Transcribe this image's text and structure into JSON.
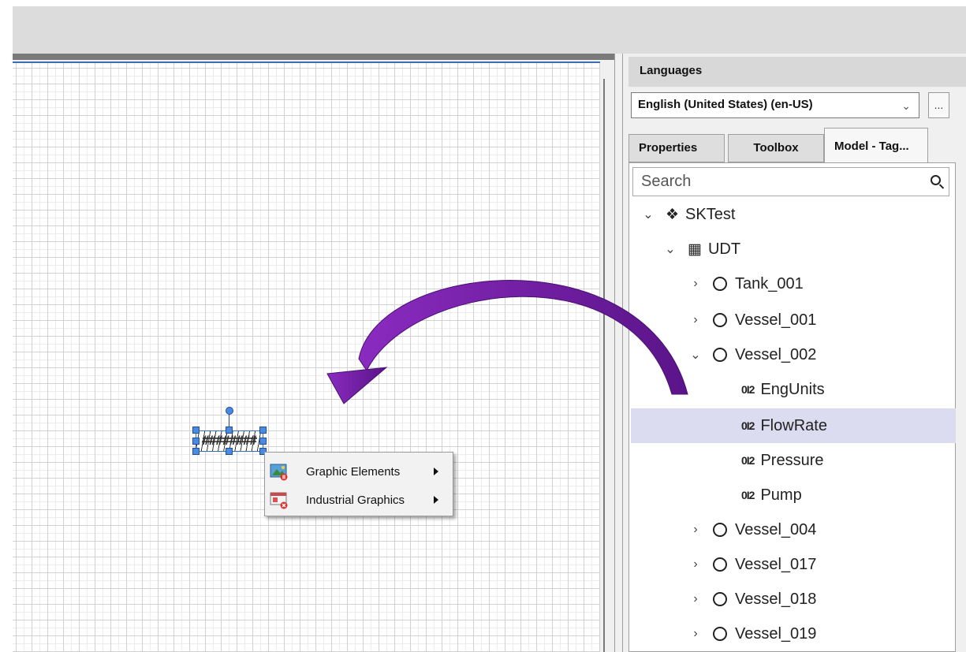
{
  "canvas": {
    "selected_element_text": "########"
  },
  "context_menu": {
    "items": [
      {
        "label": "Graphic Elements",
        "icon": "graphic-elements-icon"
      },
      {
        "label": "Industrial Graphics",
        "icon": "industrial-graphics-icon"
      }
    ]
  },
  "right_panel": {
    "languages_header": "Languages",
    "language_selected": "English (United States) (en-US)",
    "more_button": "...",
    "tabs": [
      {
        "label": "Properties",
        "active": false
      },
      {
        "label": "Toolbox",
        "active": false
      },
      {
        "label": "Model - Tag...",
        "active": true
      }
    ],
    "search_placeholder": "Search",
    "tree": [
      {
        "label": "SKTest",
        "depth": 0,
        "expander": "expanded",
        "icon": "galaxy-icon"
      },
      {
        "label": "UDT",
        "depth": 1,
        "expander": "expanded",
        "icon": "udt-icon"
      },
      {
        "label": "Tank_001",
        "depth": 2,
        "expander": "collapsed",
        "icon": "object-circle-icon"
      },
      {
        "label": "Vessel_001",
        "depth": 2,
        "expander": "collapsed",
        "icon": "object-circle-icon"
      },
      {
        "label": "Vessel_002",
        "depth": 2,
        "expander": "expanded",
        "icon": "object-circle-icon"
      },
      {
        "label": "EngUnits",
        "depth": 3,
        "expander": "none",
        "icon": "attribute-icon",
        "icon_text": "012"
      },
      {
        "label": "FlowRate",
        "depth": 3,
        "expander": "none",
        "icon": "attribute-icon",
        "icon_text": "012",
        "selected": true
      },
      {
        "label": "Pressure",
        "depth": 3,
        "expander": "none",
        "icon": "attribute-icon",
        "icon_text": "012"
      },
      {
        "label": "Pump",
        "depth": 3,
        "expander": "none",
        "icon": "attribute-icon",
        "icon_text": "012"
      },
      {
        "label": "Vessel_004",
        "depth": 2,
        "expander": "collapsed",
        "icon": "object-circle-icon"
      },
      {
        "label": "Vessel_017",
        "depth": 2,
        "expander": "collapsed",
        "icon": "object-circle-icon"
      },
      {
        "label": "Vessel_018",
        "depth": 2,
        "expander": "collapsed",
        "icon": "object-circle-icon"
      },
      {
        "label": "Vessel_019",
        "depth": 2,
        "expander": "collapsed",
        "icon": "object-circle-icon"
      }
    ]
  },
  "colors": {
    "selection_highlight": "#dcdcf1",
    "arrow_purple": "#6a1a9a",
    "handle_blue": "#4a8ae0"
  }
}
